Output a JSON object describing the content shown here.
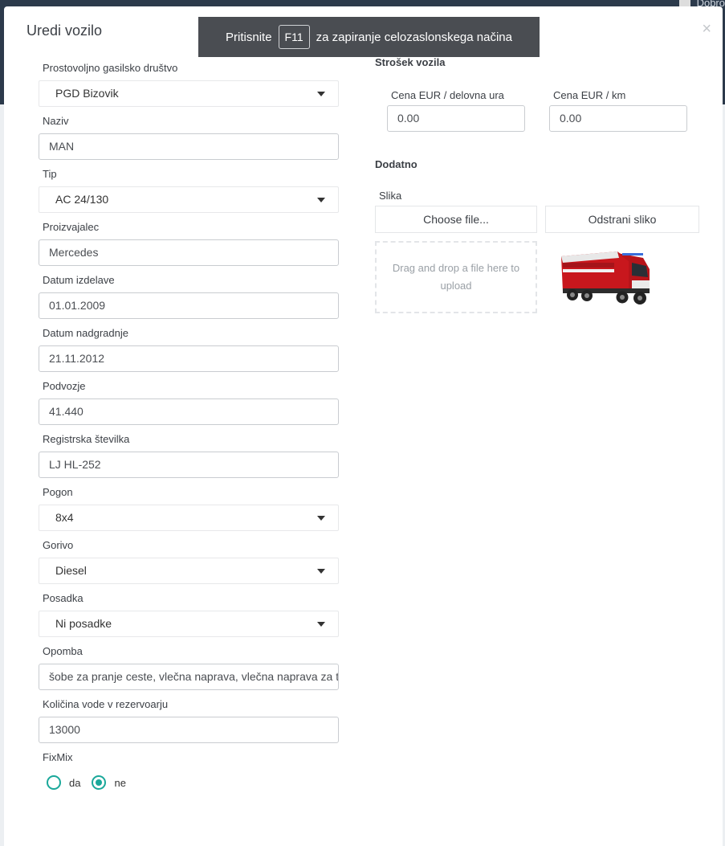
{
  "background": {
    "user_label": "Dobro"
  },
  "modal": {
    "title": "Uredi vozilo",
    "close_symbol": "×"
  },
  "toast": {
    "prefix": "Pritisnite",
    "key": "F11",
    "suffix": "za zapiranje celozaslonskega načina"
  },
  "form": {
    "drustvo": {
      "label": "Prostovoljno gasilsko društvo",
      "value": "PGD Bizovik"
    },
    "naziv": {
      "label": "Naziv",
      "value": "MAN"
    },
    "tip": {
      "label": "Tip",
      "value": "AC 24/130"
    },
    "proizvajalec": {
      "label": "Proizvajalec",
      "value": "Mercedes"
    },
    "datum_izdelave": {
      "label": "Datum izdelave",
      "value": "01.01.2009"
    },
    "datum_nadgradnje": {
      "label": "Datum nadgradnje",
      "value": "21.11.2012"
    },
    "podvozje": {
      "label": "Podvozje",
      "value": "41.440"
    },
    "registrska": {
      "label": "Registrska številka",
      "value": "LJ HL-252"
    },
    "pogon": {
      "label": "Pogon",
      "value": "8x4"
    },
    "gorivo": {
      "label": "Gorivo",
      "value": "Diesel"
    },
    "posadka": {
      "label": "Posadka",
      "value": "Ni posadke"
    },
    "opomba": {
      "label": "Opomba",
      "value": "šobe za pranje ceste, vlečna naprava, vlečna naprava za t"
    },
    "kolicina_vode": {
      "label": "Količina vode v rezervoarju",
      "value": "13000"
    },
    "fixmix": {
      "label": "FixMix",
      "options": [
        "da",
        "ne"
      ],
      "selected": "ne"
    }
  },
  "strosek": {
    "title": "Strošek vozila",
    "cena_ura": {
      "label": "Cena EUR / delovna ura",
      "value": "0.00"
    },
    "cena_km": {
      "label": "Cena EUR / km",
      "value": "0.00"
    }
  },
  "dodatno": {
    "title": "Dodatno",
    "slika_label": "Slika",
    "choose_file": "Choose file...",
    "remove_image": "Odstrani sliko",
    "drop_text": "Drag and drop a file here to upload",
    "image_icon": "fire-truck-image"
  },
  "colors": {
    "accent": "#1aa89a",
    "toast_bg": "#4a4d52",
    "header_bg": "#2c3a4b"
  }
}
